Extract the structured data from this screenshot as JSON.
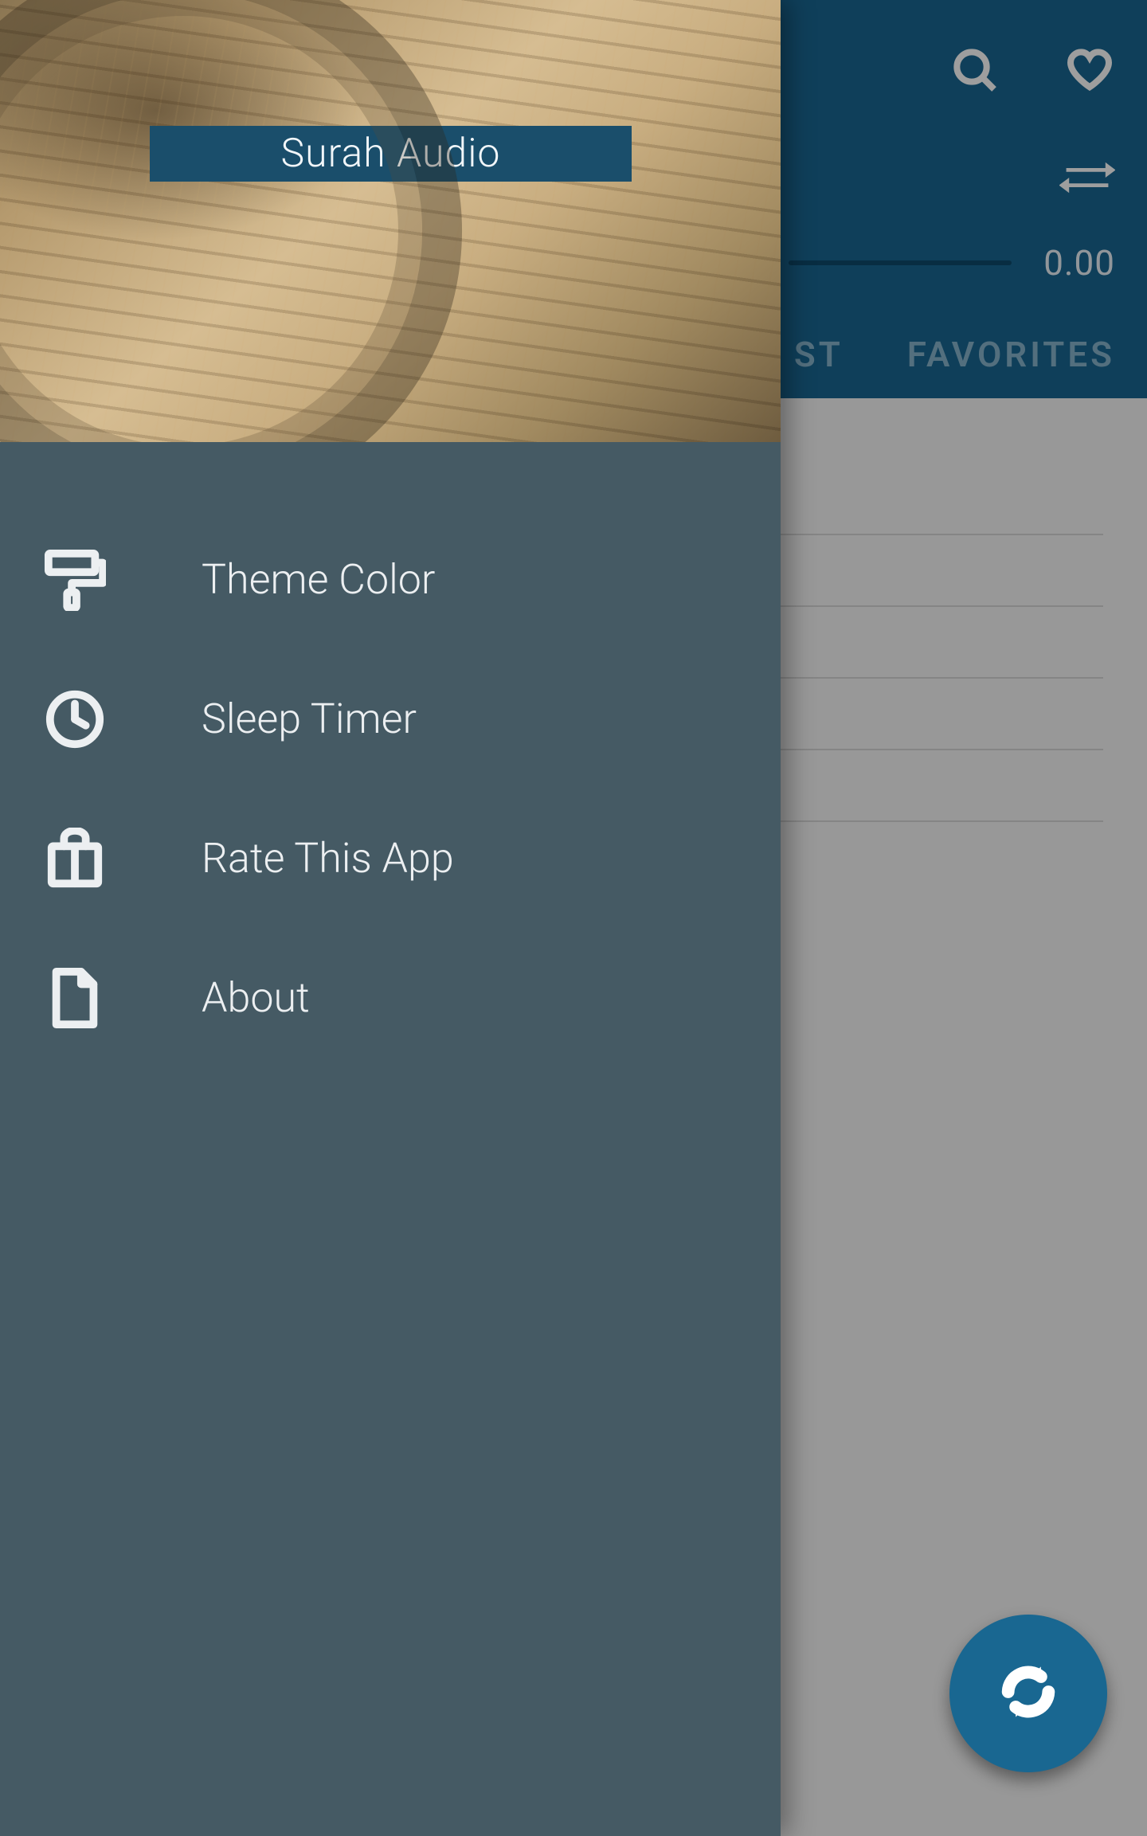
{
  "app": {
    "title": "Surah Audio"
  },
  "player": {
    "time": "0.00"
  },
  "tabs": {
    "partial_visible": "ST",
    "favorites": "FAVORITES"
  },
  "drawer": {
    "items": [
      {
        "label": "Theme Color",
        "icon": "paint-roller"
      },
      {
        "label": "Sleep Timer",
        "icon": "clock"
      },
      {
        "label": "Rate This App",
        "icon": "shopping-bag"
      },
      {
        "label": "About",
        "icon": "document"
      }
    ]
  }
}
